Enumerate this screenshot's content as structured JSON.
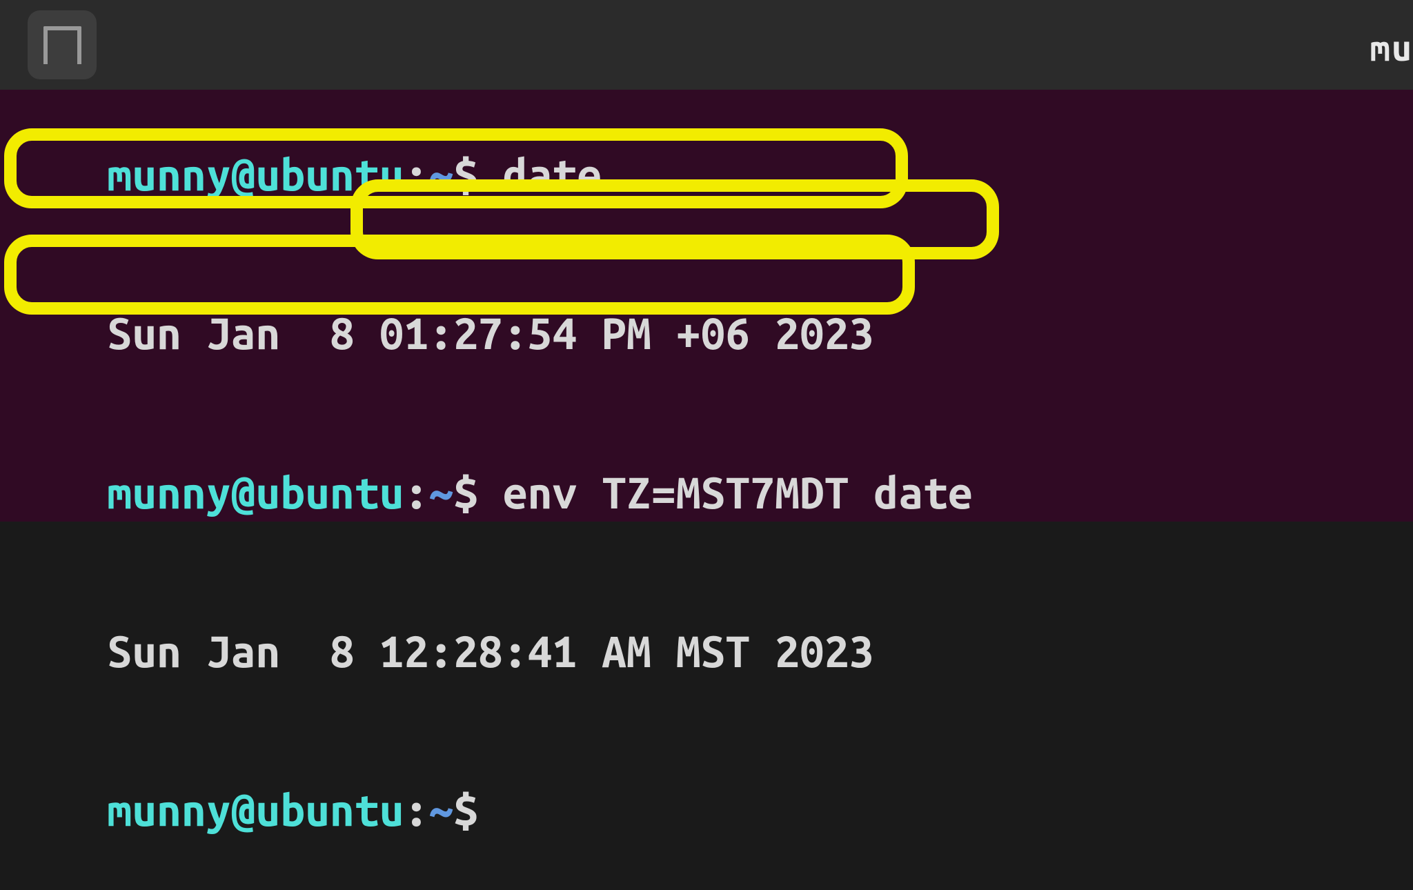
{
  "titlebar": {
    "partial_title": "mu"
  },
  "terminal": {
    "prompt_user_host": "munny@ubuntu",
    "prompt_sep": ":",
    "prompt_path": "~",
    "prompt_symbol": "$",
    "line1_cmd": "date",
    "line2_output": "Sun Jan  8 01:27:54 PM +06 2023",
    "line3_cmd": "env TZ=MST7MDT date",
    "line4_output": "Sun Jan  8 12:28:41 AM MST 2023"
  }
}
